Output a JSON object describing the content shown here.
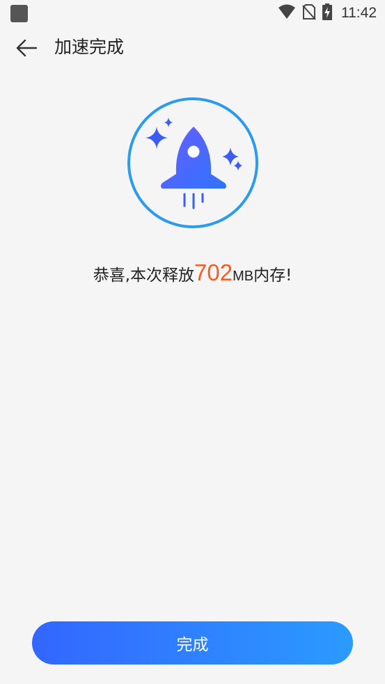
{
  "status_bar": {
    "time": "11:42",
    "icons": [
      "app-notification-icon",
      "wifi-icon",
      "no-sim-icon",
      "battery-charging-icon"
    ]
  },
  "app_bar": {
    "back_icon": "arrow-left-icon",
    "title": "加速完成"
  },
  "hero": {
    "icon": "rocket-icon",
    "decorations": "sparkle-icons"
  },
  "result": {
    "prefix": "恭喜,本次释放",
    "amount": "702",
    "unit": "MB",
    "suffix": "内存!"
  },
  "actions": {
    "done_label": "完成"
  },
  "colors": {
    "background": "#f5f5f5",
    "accent_start": "#3366ff",
    "accent_end": "#2b9bff",
    "ring": "#2b9bf0",
    "highlight": "#ff5a1e"
  }
}
